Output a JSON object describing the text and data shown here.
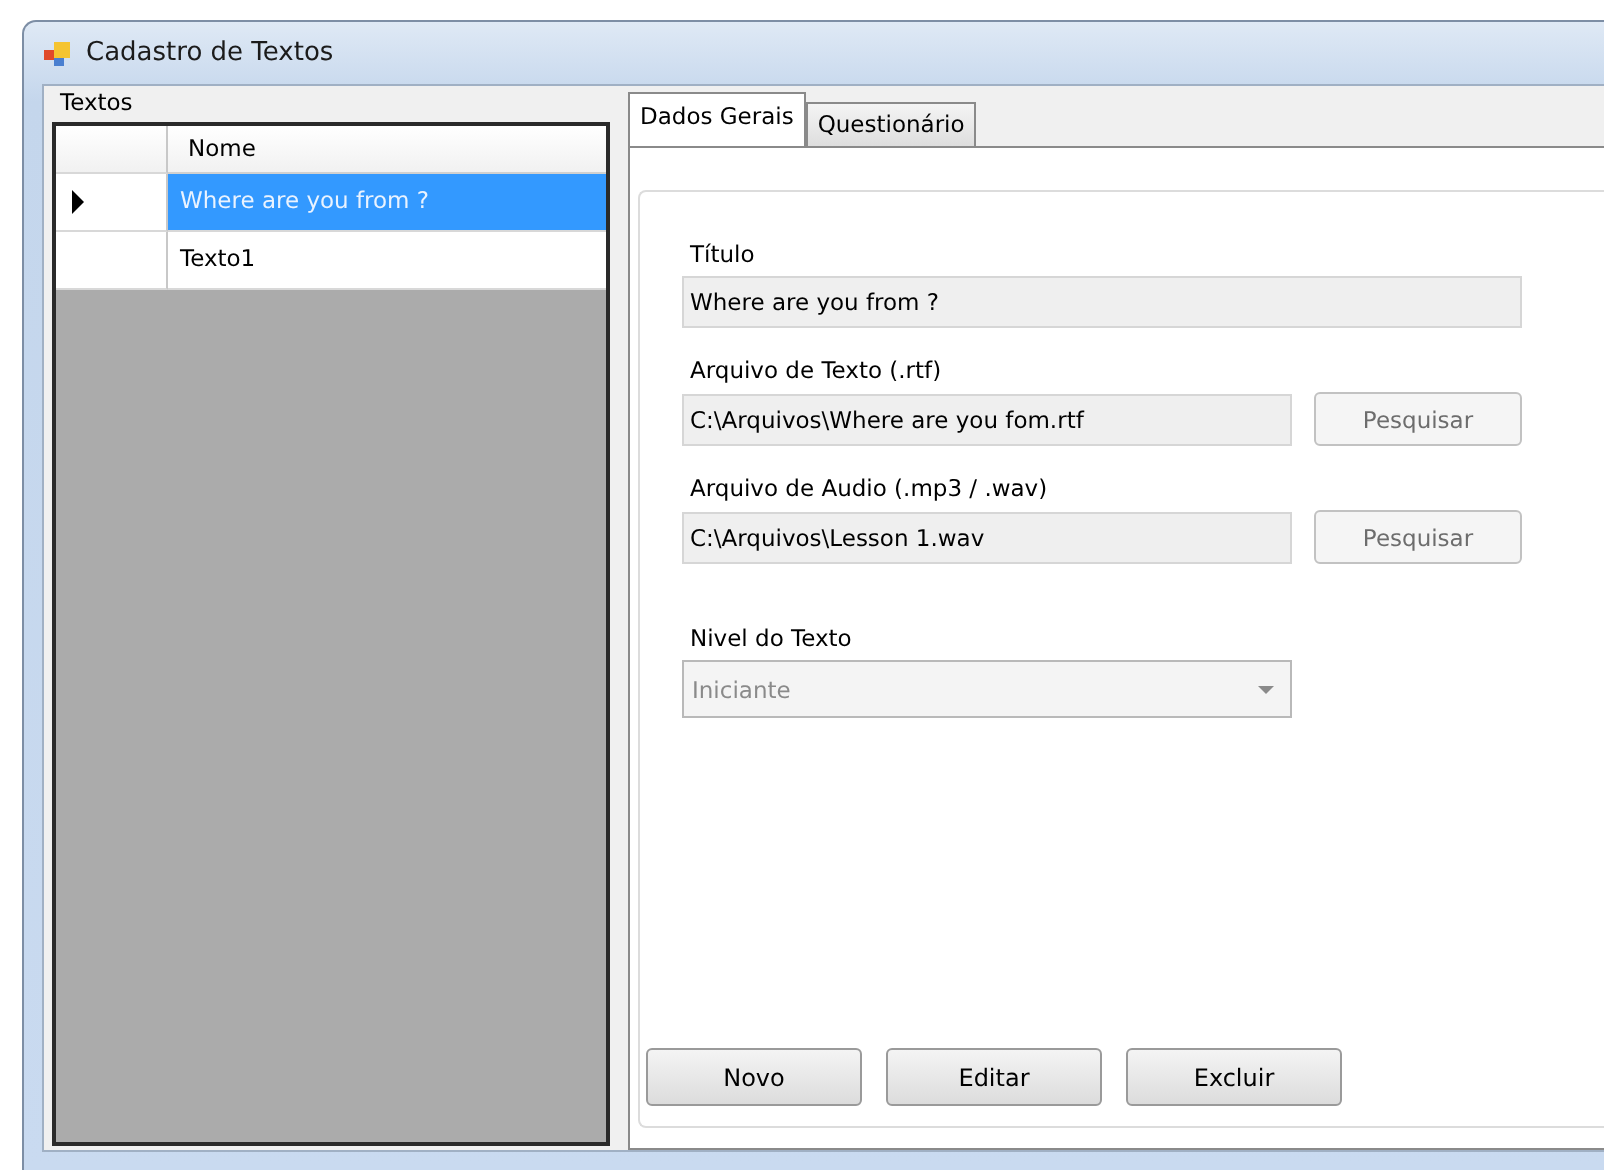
{
  "window": {
    "title": "Cadastro de Textos"
  },
  "textos_group": {
    "label": "Textos",
    "grid": {
      "columns": [
        "Nome"
      ],
      "rows": [
        {
          "cells": [
            "Where are you from ?"
          ],
          "selected": true,
          "current": true
        },
        {
          "cells": [
            "Texto1"
          ],
          "selected": false,
          "current": false
        }
      ]
    }
  },
  "tabs": [
    {
      "label": "Dados Gerais",
      "selected": true
    },
    {
      "label": "Questionário",
      "selected": false
    }
  ],
  "fields": [
    {
      "kind": "text",
      "label": "Título",
      "value": "Where are you from ?",
      "readonly": true
    },
    {
      "kind": "file",
      "label": "Arquivo de Texto (.rtf)",
      "value": "C:\\Arquivos\\Where are you fom.rtf",
      "readonly": true,
      "button": "Pesquisar"
    },
    {
      "kind": "file",
      "label": "Arquivo de Audio (.mp3 / .wav)",
      "value": "C:\\Arquivos\\Lesson 1.wav",
      "readonly": true,
      "button": "Pesquisar"
    },
    {
      "kind": "combo",
      "label": "Nivel do Texto",
      "value": "Iniciante",
      "disabled": true
    }
  ],
  "buttons": [
    "Novo",
    "Editar",
    "Excluir"
  ]
}
